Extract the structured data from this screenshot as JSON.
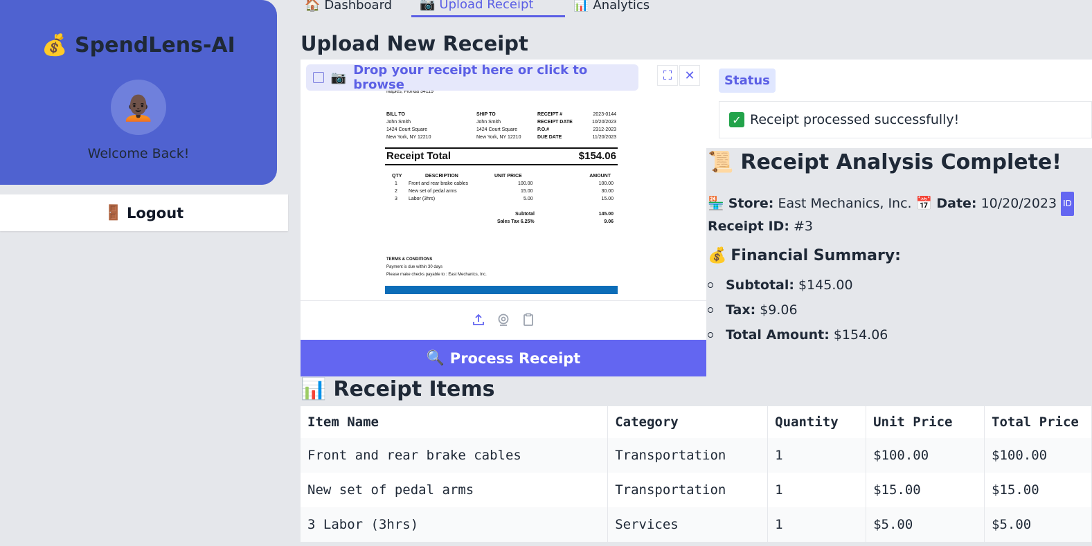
{
  "sidebar": {
    "app_icon": "money-bag-icon",
    "app_title": "SpendLens-AI",
    "avatar_icon": "person-icon",
    "welcome": "Welcome Back!",
    "logout_label": "Logout",
    "logout_icon": "door-icon",
    "accent": "#4f62d0"
  },
  "tabs": [
    {
      "label": "Dashboard",
      "icon": "house-icon"
    },
    {
      "label": "Upload Receipt",
      "icon": "camera-icon",
      "active": true
    },
    {
      "label": "Analytics",
      "icon": "bar-chart-icon"
    }
  ],
  "page_title": "Upload New Receipt",
  "upload": {
    "drop_text": "Drop your receipt here or click to browse",
    "process_label": "Process Receipt",
    "receipt": {
      "address": "Naples, Florida 34119",
      "bill_to_label": "BILL TO",
      "ship_to_label": "SHIP TO",
      "bill_to_name": "John Smith",
      "bill_to_street": "1424 Court Square",
      "bill_to_city": "New York, NY 12210",
      "ship_to_name": "John Smith",
      "ship_to_street": "1424 Court Square",
      "ship_to_city": "New York, NY 12210",
      "receipt_no_label": "RECEIPT #",
      "receipt_no": "2023-0144",
      "receipt_date_label": "RECEIPT DATE",
      "receipt_date": "10/20/2023",
      "po_label": "P.O.#",
      "po": "2312-2023",
      "due_label": "DUE DATE",
      "due": "11/20/2023",
      "total_label": "Receipt Total",
      "total": "$154.06",
      "col_qty": "QTY",
      "col_desc": "DESCRIPTION",
      "col_unit": "UNIT PRICE",
      "col_amount": "AMOUNT",
      "lines": [
        {
          "qty": "1",
          "desc": "Front and rear brake cables",
          "unit": "100.00",
          "amount": "100.00"
        },
        {
          "qty": "2",
          "desc": "New set of pedal arms",
          "unit": "15.00",
          "amount": "30.00"
        },
        {
          "qty": "3",
          "desc": "Labor (3hrs)",
          "unit": "5.00",
          "amount": "15.00"
        }
      ],
      "subtotal_label": "Subtotal",
      "subtotal": "145.00",
      "tax_label": "Sales Tax 6.25%",
      "tax": "9.06",
      "terms_title": "TERMS & CONDITIONS",
      "terms_1": "Payment is due within 30 days",
      "terms_2": "Please make checks payable to : East Mechanics, Inc."
    }
  },
  "status": {
    "label": "Status",
    "message": "Receipt processed successfully!"
  },
  "analysis": {
    "title": "Receipt Analysis Complete!",
    "store_label": "Store:",
    "store": "East Mechanics, Inc.",
    "date_label": "Date:",
    "date": "10/20/2023",
    "id_badge": "ID",
    "receipt_id_label": "Receipt ID:",
    "receipt_id": "#3",
    "financial_title": "Financial Summary:",
    "subtotal_label": "Subtotal:",
    "subtotal": "$145.00",
    "tax_label": "Tax:",
    "tax": "$9.06",
    "total_label": "Total Amount:",
    "total": "$154.06"
  },
  "items": {
    "title": "Receipt Items",
    "headers": [
      "Item Name",
      "Category",
      "Quantity",
      "Unit Price",
      "Total Price"
    ],
    "rows": [
      [
        "Front and rear brake cables",
        "Transportation",
        "1",
        "$100.00",
        "$100.00"
      ],
      [
        "New set of pedal arms",
        "Transportation",
        "1",
        "$15.00",
        "$15.00"
      ],
      [
        "3 Labor (3hrs)",
        "Services",
        "1",
        "$5.00",
        "$5.00"
      ]
    ]
  }
}
